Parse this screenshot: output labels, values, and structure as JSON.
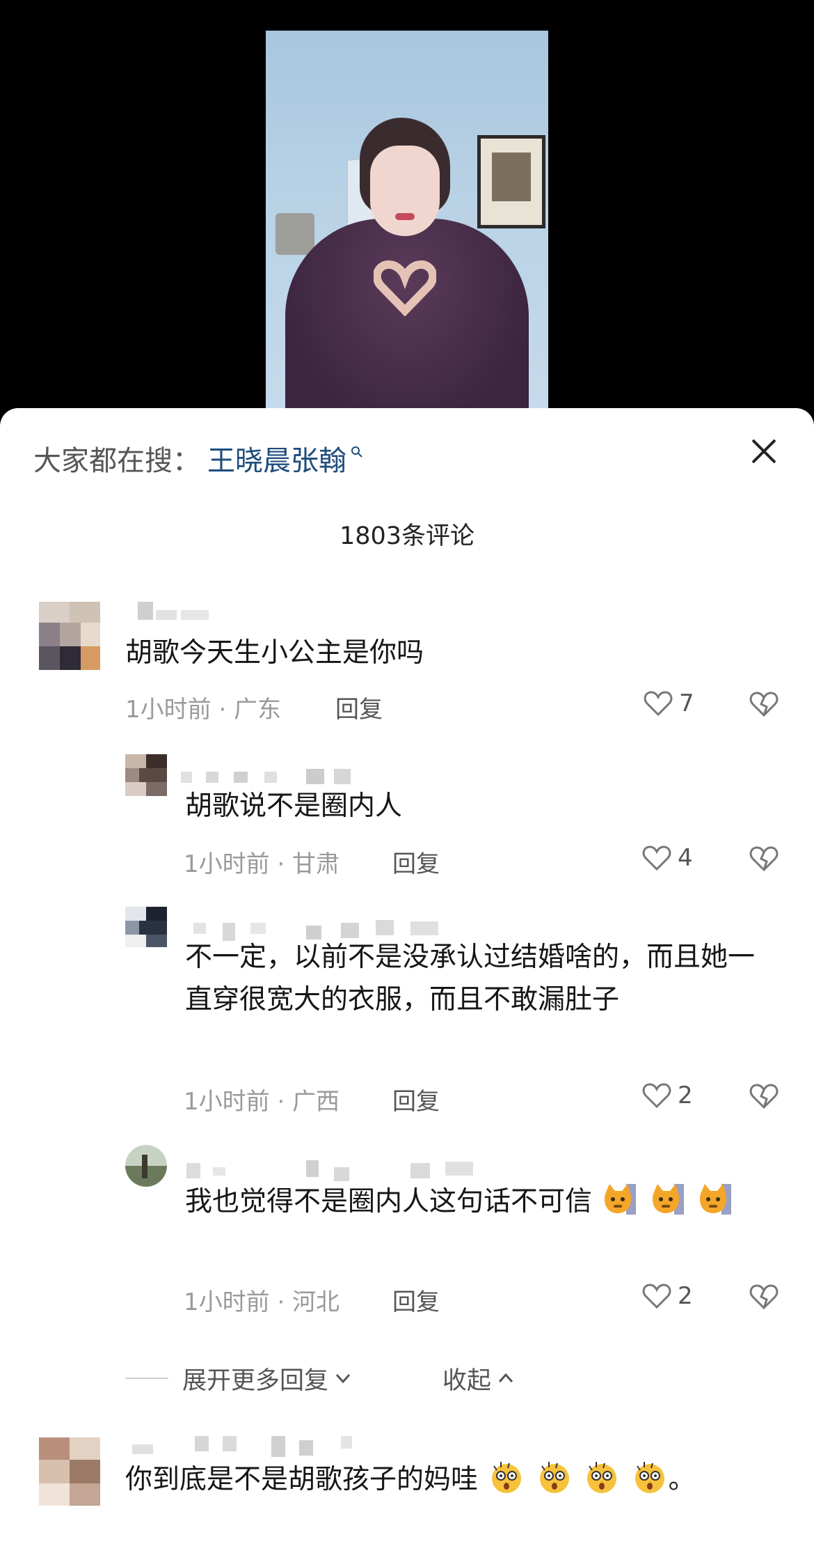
{
  "search": {
    "label": "大家都在搜：",
    "term": "王晓晨张翰"
  },
  "comments_count": "1803条评论",
  "comments": [
    {
      "text": "胡歌今天生小公主是你吗",
      "meta": "1小时前 · 广东",
      "reply": "回复",
      "likes": "7"
    },
    {
      "text": "胡歌说不是圈内人",
      "meta": "1小时前 · 甘肃",
      "reply": "回复",
      "likes": "4"
    },
    {
      "text": "不一定，以前不是没承认过结婚啥的，而且她一直穿很宽大的衣服，而且不敢漏肚子",
      "meta": "1小时前 · 广西",
      "reply": "回复",
      "likes": "2"
    },
    {
      "text": "我也觉得不是圈内人这句话不可信",
      "meta": "1小时前 · 河北",
      "reply": "回复",
      "likes": "2"
    },
    {
      "text": "你到底是不是胡歌孩子的妈哇",
      "suffix": "。"
    }
  ],
  "expand_label": "展开更多回复",
  "collapse_label": "收起",
  "icons": [
    "search-icon",
    "close-icon",
    "heart-icon",
    "broken-heart-icon",
    "chevron-down-icon",
    "chevron-up-icon",
    "cat-emoji-icon",
    "shocked-emoji-icon"
  ]
}
